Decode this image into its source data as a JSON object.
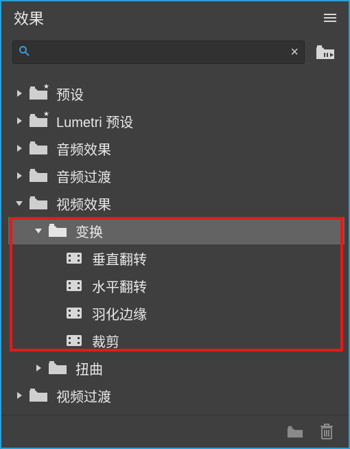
{
  "panel": {
    "title": "效果"
  },
  "search": {
    "placeholder": "",
    "value": ""
  },
  "tree": {
    "presets": "预设",
    "lumetri": "Lumetri 预设",
    "audio_effects": "音频效果",
    "audio_transitions": "音频过渡",
    "video_effects": "视频效果",
    "transform": "变换",
    "vertical_flip": "垂直翻转",
    "horizontal_flip": "水平翻转",
    "feather_edges": "羽化边缘",
    "crop": "裁剪",
    "distort": "扭曲",
    "video_transitions": "视频过渡"
  },
  "icons": {
    "search": "⚲",
    "clear": "×",
    "star": "★"
  }
}
